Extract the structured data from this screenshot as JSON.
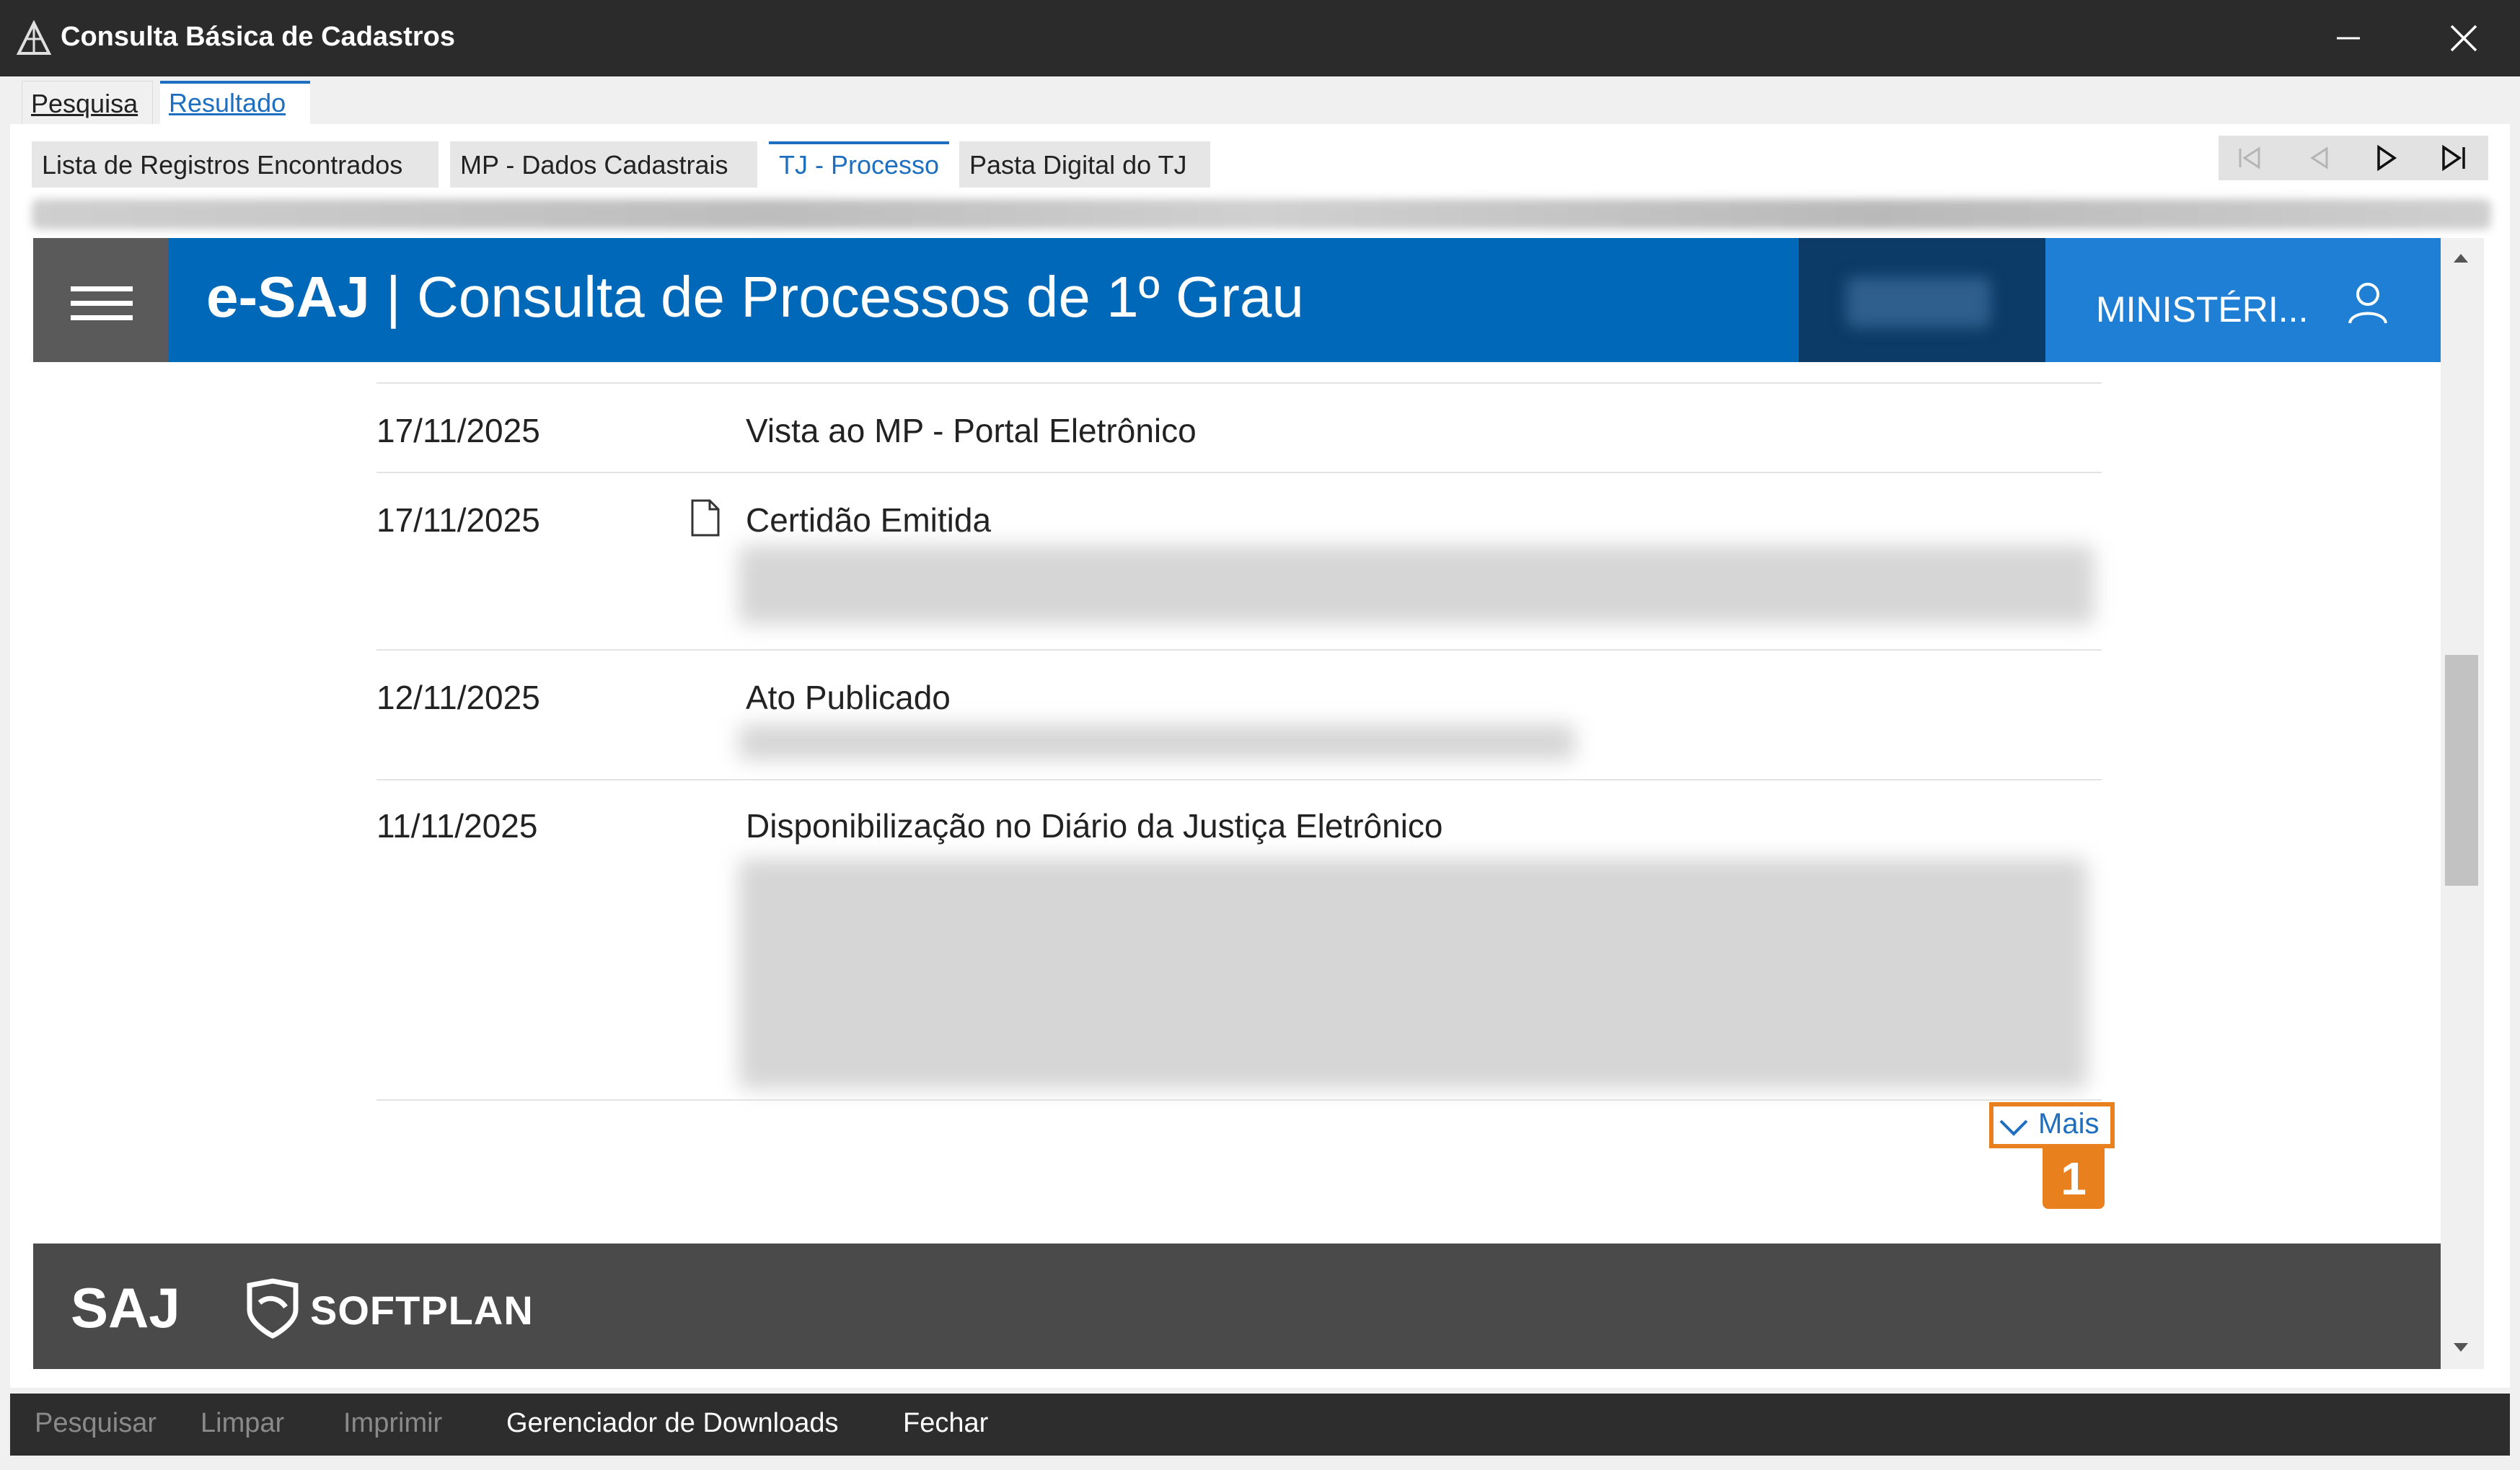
{
  "window": {
    "title": "Consulta Básica de Cadastros",
    "minimize_glyph": "–",
    "close_glyph": "✕"
  },
  "top_tabs": [
    {
      "label": "Pesquisa",
      "active": false
    },
    {
      "label": "Resultado",
      "active": true
    }
  ],
  "sub_tabs": [
    {
      "label": "Lista de Registros Encontrados",
      "active": false
    },
    {
      "label": "MP - Dados Cadastrais",
      "active": false
    },
    {
      "label": "TJ - Processo",
      "active": true
    },
    {
      "label": "Pasta Digital do TJ",
      "active": false
    }
  ],
  "nav_buttons": [
    {
      "icon": "first-record-icon",
      "enabled": false
    },
    {
      "icon": "previous-record-icon",
      "enabled": false
    },
    {
      "icon": "next-record-icon",
      "enabled": true
    },
    {
      "icon": "last-record-icon",
      "enabled": true
    }
  ],
  "esaj": {
    "brand": "e-SAJ",
    "separator": "|",
    "title": "Consulta de Processos de 1º Grau",
    "user_label": "MINISTÉRI...",
    "header_color": "#0068b8",
    "user_block_color": "#1e7fd4"
  },
  "movimentacoes": [
    {
      "date": "17/11/2025",
      "description": "Vista ao MP - Portal Eletrônico",
      "has_document": false
    },
    {
      "date": "17/11/2025",
      "description": "Certidão Emitida",
      "has_document": true
    },
    {
      "date": "12/11/2025",
      "description": "Ato Publicado",
      "has_document": false
    },
    {
      "date": "11/11/2025",
      "description": "Disponibilização no Diário da Justiça Eletrônico",
      "has_document": false
    }
  ],
  "mais": {
    "label": "Mais",
    "badge": "1",
    "highlight_color": "#e8801e"
  },
  "footer": {
    "saj_logo": "SAJ",
    "softplan_logo": "SOFTPLAN"
  },
  "commands": [
    {
      "label": "Pesquisar",
      "enabled": false
    },
    {
      "label": "Limpar",
      "enabled": false
    },
    {
      "label": "Imprimir",
      "enabled": false
    },
    {
      "label": "Gerenciador de Downloads",
      "enabled": true
    },
    {
      "label": "Fechar",
      "enabled": true
    }
  ]
}
